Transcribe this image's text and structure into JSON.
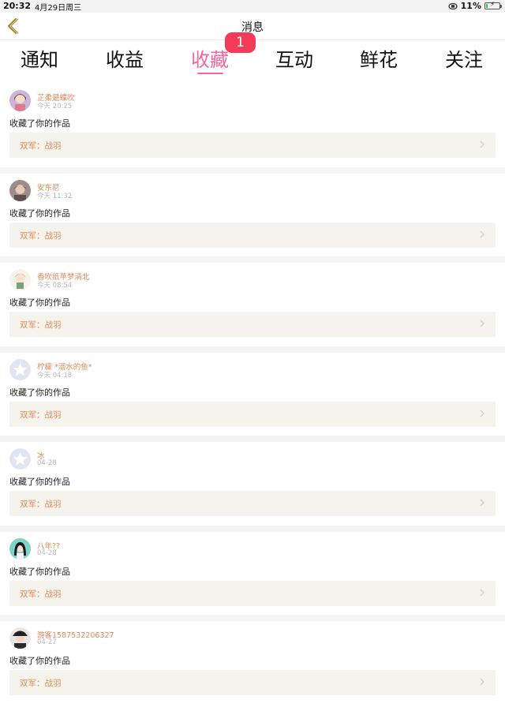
{
  "status_bar": {
    "time": "20:32",
    "date": "4月29日周三",
    "battery": "11%",
    "battery_level": 0.11
  },
  "nav": {
    "title": "消息"
  },
  "tabs": [
    {
      "label": "通知",
      "active": false
    },
    {
      "label": "收益",
      "active": false
    },
    {
      "label": "收藏",
      "active": true,
      "badge": "1"
    },
    {
      "label": "互动",
      "active": false
    },
    {
      "label": "鲜花",
      "active": false
    },
    {
      "label": "关注",
      "active": false
    }
  ],
  "colors": {
    "accent": "#f1679e",
    "badge": "#f43a59",
    "username": "#e3885a",
    "work_bg": "#f5f4ec"
  },
  "messages": [
    {
      "username": "芷柔是蝶吹",
      "time": "今天 20:25",
      "action": "收藏了你的作品",
      "work": "双军：战羽",
      "avatar": "girl-avatar-icon"
    },
    {
      "username": "安东尼",
      "time": "今天 11:32",
      "action": "收藏了你的作品",
      "work": "双军：战羽",
      "avatar": "man-avatar-icon"
    },
    {
      "username": "香吹纸苹梦清北",
      "time": "今天 08:54",
      "action": "收藏了你的作品",
      "work": "双军：战羽",
      "avatar": "chibi-avatar-icon"
    },
    {
      "username": "柠檬 *溺水的鱼*",
      "time": "今天 04:18",
      "action": "收藏了你的作品",
      "work": "双军：战羽",
      "avatar": "default-star-avatar-icon"
    },
    {
      "username": "冰",
      "time": "04-28",
      "action": "收藏了你的作品",
      "work": "双军：战羽",
      "avatar": "default-star-avatar-icon"
    },
    {
      "username": "八年??",
      "time": "04-28",
      "action": "收藏了你的作品",
      "work": "双军：战羽",
      "avatar": "girl-portrait-avatar-icon"
    },
    {
      "username": "游客1587532206327",
      "time": "04-27",
      "action": "收藏了你的作品",
      "work": "双军：战羽",
      "avatar": "hat-avatar-icon"
    }
  ]
}
